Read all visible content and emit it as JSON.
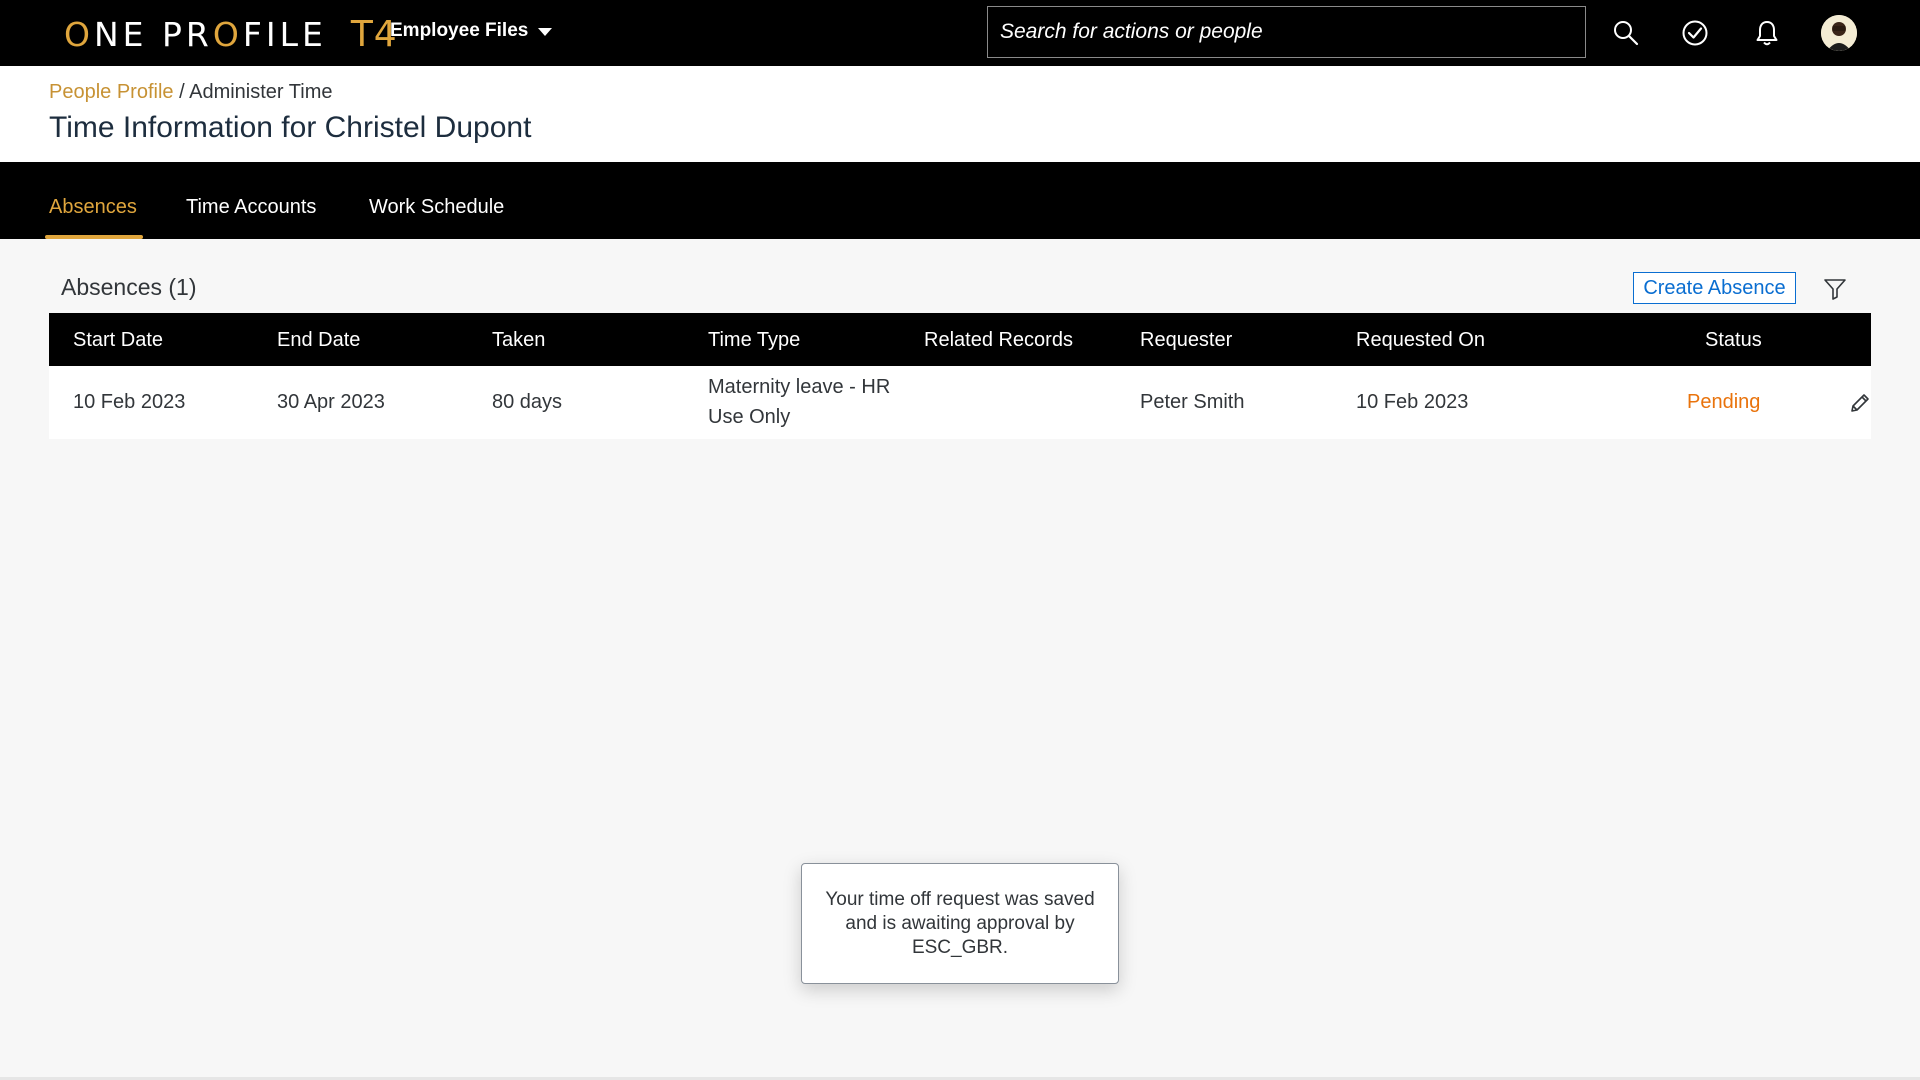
{
  "shell": {
    "logo_left": "ONE PR",
    "logo_o": "O",
    "logo_right": "FILE",
    "logo_o_first": "O",
    "logo_ne": "NE",
    "logo_t4": "T4",
    "menu_label": "Employee Files",
    "search_placeholder": "Search for actions or people",
    "icons": [
      "search-icon",
      "approve-check-icon",
      "notification-bell-icon",
      "user-avatar"
    ]
  },
  "header": {
    "breadcrumb_link": "People Profile",
    "breadcrumb_sep": " / ",
    "breadcrumb_current": "Administer Time",
    "title": "Time Information for Christel Dupont"
  },
  "tabs": [
    {
      "label": "Absences",
      "active": true
    },
    {
      "label": "Time Accounts",
      "active": false
    },
    {
      "label": "Work Schedule",
      "active": false
    }
  ],
  "absences": {
    "title": "Absences (1)",
    "create_label": "Create Absence",
    "columns": [
      "Start Date",
      "End Date",
      "Taken",
      "Time Type",
      "Related Records",
      "Requester",
      "Requested On",
      "Status"
    ],
    "rows": [
      {
        "start_date": "10 Feb 2023",
        "end_date": "30 Apr 2023",
        "taken": "80 days",
        "time_type_line1": "Maternity leave - HR",
        "time_type_line2": "Use Only",
        "related_records": "",
        "requester": "Peter Smith",
        "requested_on": "10 Feb 2023",
        "status": "Pending"
      }
    ]
  },
  "toast": {
    "message": "Your time off request was saved and is awaiting approval by ESC_GBR."
  },
  "colors": {
    "accent_gold": "#e0a63d",
    "link_blue": "#0a6ed1",
    "pending_orange": "#e9730c",
    "shell_bg": "#000000"
  }
}
